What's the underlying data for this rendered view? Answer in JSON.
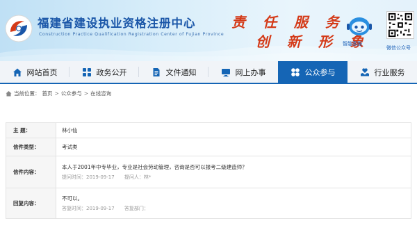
{
  "header": {
    "title": "福建省建设执业资格注册中心",
    "subtitle": "Construction Practice Qualification Registration Center of Fujian Province",
    "slogan_line1": "责 任  服 务",
    "slogan_line2": "创 新  形 象",
    "service_label": "智能客服",
    "qr_label": "微信公众号",
    "brand_color": "#1a56a8",
    "slogan_color": "#d43a18"
  },
  "nav": {
    "items": [
      {
        "label": "网站首页",
        "icon": "home-icon"
      },
      {
        "label": "政务公开",
        "icon": "grid-icon"
      },
      {
        "label": "文件通知",
        "icon": "document-icon"
      },
      {
        "label": "网上办事",
        "icon": "monitor-icon"
      },
      {
        "label": "公众参与",
        "icon": "clover-icon",
        "active": true
      },
      {
        "label": "行业服务",
        "icon": "hands-icon"
      }
    ],
    "active_color": "#1565b5"
  },
  "breadcrumb": {
    "prefix": "当前位置：",
    "items": [
      "首页",
      "公众参与",
      "在线咨询"
    ],
    "separator": ">"
  },
  "detail": {
    "subject_label": "主  题：",
    "subject_value": "林小仙",
    "type_label": "信件类型：",
    "type_value": "考试类",
    "content_label": "信件内容：",
    "content_value": "本人于2001年中专毕业，专业是社会劳动管理，咨询是否可以报考二级建造师？",
    "submit_time_label": "提问时间：",
    "submit_time_value": "2019-09-17",
    "asker_label": "提问人：",
    "asker_value": "林*",
    "reply_label": "回复内容：",
    "reply_value": "不可以。",
    "reply_time_label": "答复时间：",
    "reply_time_value": "2019-09-17",
    "reply_dept_label": "答复部门："
  }
}
